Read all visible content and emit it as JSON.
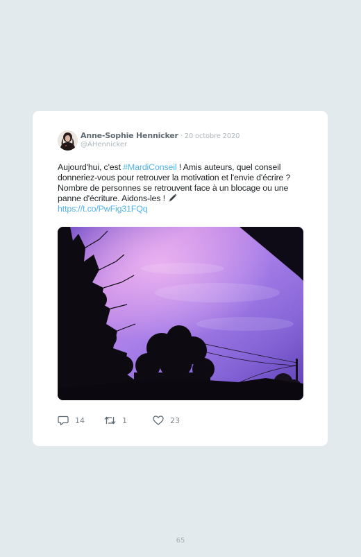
{
  "tweet": {
    "author_name": "Anne-Sophie Hennicker",
    "separator": " · ",
    "date": "20 octobre 2020",
    "handle": "@AHennicker",
    "text_before": "Aujourd'hui, c'est ",
    "hashtag": "#MardiConseil",
    "text_after": " ! Amis auteurs, quel conseil donneriez-vous pour retrouver la motivation et l'envie d'écrire ? Nombre de personnes se retrouvent face à un blocage ou une panne d'écriture. Aidons-les ! ",
    "link": "https://t.co/PwFig31FQq",
    "photo_icon": "purple-sunset-sky-photo",
    "colors": {
      "link": "#4fb3e8",
      "text": "#1e2326",
      "name": "#5f6a72",
      "muted": "#aeb7bc",
      "background": "#e3eaed",
      "card": "#ffffff"
    }
  },
  "actions": {
    "replies": "14",
    "retweets": "1",
    "likes": "23",
    "reply_icon": "reply-icon",
    "retweet_icon": "retweet-icon",
    "like_icon": "heart-icon"
  },
  "page": {
    "number": "65"
  }
}
